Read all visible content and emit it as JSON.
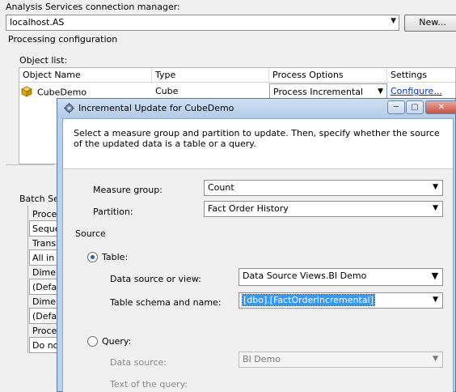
{
  "header": {
    "connection_label": "Analysis Services connection manager:",
    "connection_value": "localhost.AS",
    "new_button": "New...",
    "processing_title": "Processing configuration",
    "object_list_label": "Object list:"
  },
  "object_list": {
    "columns": [
      "Object Name",
      "Type",
      "Process Options",
      "Settings"
    ],
    "rows": [
      {
        "name": "CubeDemo",
        "type": "Cube",
        "process_option": "Process Incremental",
        "settings": "Configure..."
      }
    ]
  },
  "batch_settings": {
    "title": "Batch Setti",
    "items": [
      {
        "head": "Process",
        "value": "Sequer"
      },
      {
        "head": "Transa",
        "value": "All in o"
      },
      {
        "head": "Dimen",
        "value": "(Defaul"
      },
      {
        "head": "Dimen",
        "value": "(Defaul"
      },
      {
        "head": "Process",
        "value": "Do not"
      }
    ]
  },
  "dialog": {
    "title": "Incremental Update for CubeDemo",
    "description": "Select a measure group and partition to update. Then, specify whether the source of the updated data is a table or a query.",
    "measure_group_label": "Measure group:",
    "measure_group_value": "Count",
    "partition_label": "Partition:",
    "partition_value": "Fact Order History",
    "source_label": "Source",
    "table_radio": "Table:",
    "data_source_view_label": "Data source or view:",
    "data_source_view_value": "Data Source Views.BI Demo",
    "table_schema_label": "Table schema and name:",
    "table_schema_value": "[dbo].[FactOrderIncremental]",
    "query_radio": "Query:",
    "data_source_label": "Data source:",
    "data_source_value": "BI Demo",
    "query_text_label": "Text of the query:"
  },
  "icons": {
    "cube": "cube-icon",
    "dialog": "gear-icon",
    "minimize": "minimize-icon",
    "maximize": "maximize-icon",
    "close": "close-icon"
  },
  "colors": {
    "link": "#0033cc",
    "selection": "#3399ff",
    "title_bar": "#b9d1ea"
  }
}
